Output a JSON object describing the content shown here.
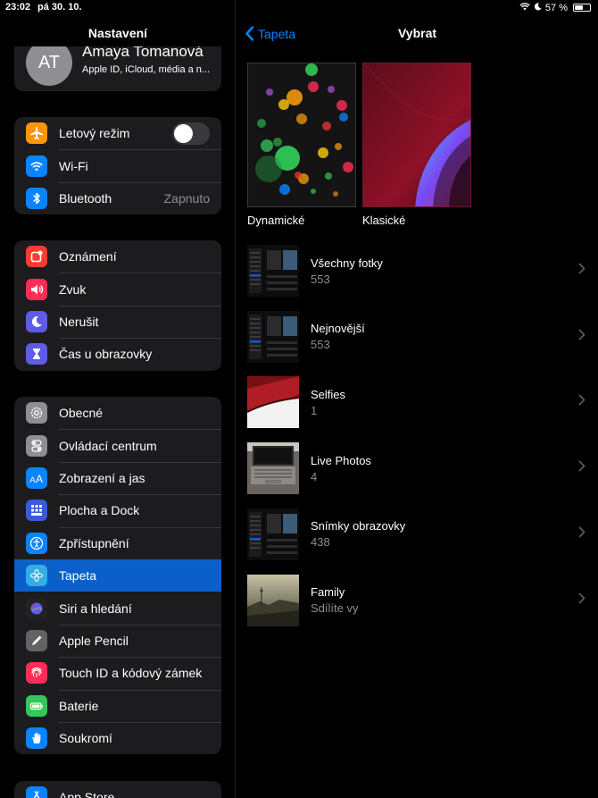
{
  "status": {
    "time": "23:02",
    "date": "pá 30. 10.",
    "battery": "57 %",
    "battery_level": 0.57
  },
  "sidebar": {
    "title": "Nastavení",
    "profile": {
      "initials": "AT",
      "name": "Amaya Tomanová",
      "subtitle": "Apple ID, iCloud, média a n..."
    },
    "group1": [
      {
        "label": "Letový režim",
        "icon": "airplane-icon",
        "color": "#ff9500",
        "toggle": false
      },
      {
        "label": "Wi-Fi",
        "icon": "wifi-icon",
        "color": "#0a84ff"
      },
      {
        "label": "Bluetooth",
        "icon": "bluetooth-icon",
        "color": "#0a84ff",
        "value": "Zapnuto"
      }
    ],
    "group2": [
      {
        "label": "Oznámení",
        "icon": "notifications-icon",
        "color": "#ff3b30"
      },
      {
        "label": "Zvuk",
        "icon": "speaker-icon",
        "color": "#ff2d55"
      },
      {
        "label": "Nerušit",
        "icon": "moon-icon",
        "color": "#5e5ce6"
      },
      {
        "label": "Čas u obrazovky",
        "icon": "hourglass-icon",
        "color": "#5e5ce6"
      }
    ],
    "group3": [
      {
        "label": "Obecné",
        "icon": "gear-icon",
        "color": "#8e8e93"
      },
      {
        "label": "Ovládací centrum",
        "icon": "toggles-icon",
        "color": "#8e8e93"
      },
      {
        "label": "Zobrazení a jas",
        "icon": "text-size-icon",
        "color": "#0a84ff"
      },
      {
        "label": "Plocha a Dock",
        "icon": "grid-icon",
        "color": "#3a5bd9"
      },
      {
        "label": "Zpřístupnění",
        "icon": "accessibility-icon",
        "color": "#0a84ff"
      },
      {
        "label": "Tapeta",
        "icon": "flower-icon",
        "color": "#32ade6",
        "selected": true
      },
      {
        "label": "Siri a hledání",
        "icon": "siri-icon",
        "color": "#222222"
      },
      {
        "label": "Apple Pencil",
        "icon": "pencil-icon",
        "color": "#636366"
      },
      {
        "label": "Touch ID a kódový zámek",
        "icon": "fingerprint-icon",
        "color": "#ff2d55"
      },
      {
        "label": "Baterie",
        "icon": "battery-icon",
        "color": "#34c759"
      },
      {
        "label": "Soukromí",
        "icon": "hand-icon",
        "color": "#0a84ff"
      }
    ],
    "group4": [
      {
        "label": "App Store",
        "icon": "appstore-icon",
        "color": "#0a84ff"
      }
    ]
  },
  "main": {
    "back_label": "Tapeta",
    "title": "Vybrat",
    "wallpapers": [
      {
        "label": "Dynamické"
      },
      {
        "label": "Klasické"
      }
    ],
    "albums": [
      {
        "name": "Všechny fotky",
        "count": "553",
        "thumb": "screenshot"
      },
      {
        "name": "Nejnovější",
        "count": "553",
        "thumb": "screenshot"
      },
      {
        "name": "Selfies",
        "count": "1",
        "thumb": "red"
      },
      {
        "name": "Live Photos",
        "count": "4",
        "thumb": "laptop"
      },
      {
        "name": "Snímky obrazovky",
        "count": "438",
        "thumb": "screenshot"
      },
      {
        "name": "Family",
        "count": "Sdílíte vy",
        "thumb": "landscape"
      }
    ]
  }
}
